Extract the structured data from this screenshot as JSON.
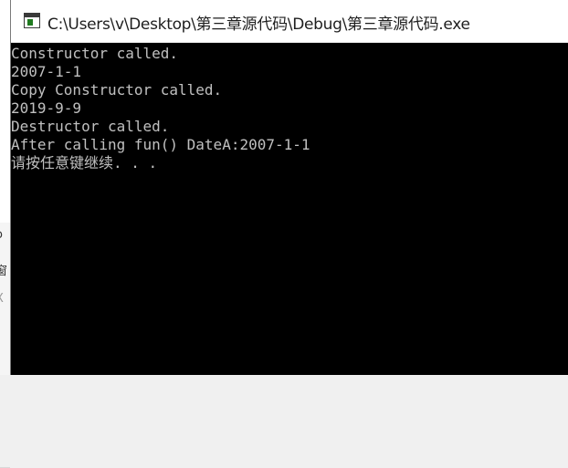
{
  "window": {
    "title": "C:\\Users\\v\\Desktop\\第三章源代码\\Debug\\第三章源代码.exe",
    "icon": "console-app-icon"
  },
  "console": {
    "lines": [
      "Constructor called.",
      "2007-1-1",
      "Copy Constructor called.",
      "2019-9-9",
      "Destructor called.",
      "After calling fun() DateA:2007-1-1",
      "请按任意键继续. . ."
    ],
    "text_color": "#c0c0c0",
    "background": "#000000"
  },
  "background_window": {
    "fragments": [
      "o",
      "窗",
      "X"
    ]
  }
}
